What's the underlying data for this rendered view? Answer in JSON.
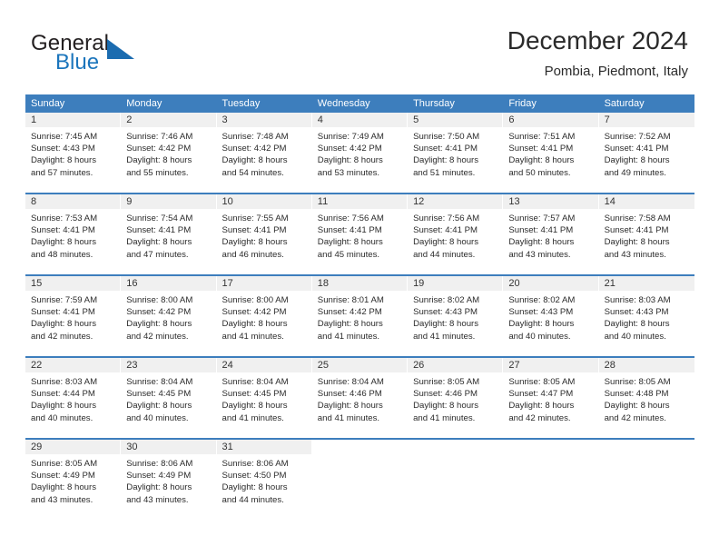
{
  "brand": {
    "name_part1": "General",
    "name_part2": "Blue",
    "logo_icon": "triangle-logo-icon",
    "accent_color": "#1b75bc"
  },
  "header": {
    "title": "December 2024",
    "subtitle": "Pombia, Piedmont, Italy"
  },
  "calendar": {
    "header_bg": "#3d7ebd",
    "day_cell_bg": "#f0f0f0",
    "weekday_headers": [
      "Sunday",
      "Monday",
      "Tuesday",
      "Wednesday",
      "Thursday",
      "Friday",
      "Saturday"
    ],
    "weeks": [
      [
        {
          "day": "1",
          "sunrise": "Sunrise: 7:45 AM",
          "sunset": "Sunset: 4:43 PM",
          "daylight_line1": "Daylight: 8 hours",
          "daylight_line2": "and 57 minutes."
        },
        {
          "day": "2",
          "sunrise": "Sunrise: 7:46 AM",
          "sunset": "Sunset: 4:42 PM",
          "daylight_line1": "Daylight: 8 hours",
          "daylight_line2": "and 55 minutes."
        },
        {
          "day": "3",
          "sunrise": "Sunrise: 7:48 AM",
          "sunset": "Sunset: 4:42 PM",
          "daylight_line1": "Daylight: 8 hours",
          "daylight_line2": "and 54 minutes."
        },
        {
          "day": "4",
          "sunrise": "Sunrise: 7:49 AM",
          "sunset": "Sunset: 4:42 PM",
          "daylight_line1": "Daylight: 8 hours",
          "daylight_line2": "and 53 minutes."
        },
        {
          "day": "5",
          "sunrise": "Sunrise: 7:50 AM",
          "sunset": "Sunset: 4:41 PM",
          "daylight_line1": "Daylight: 8 hours",
          "daylight_line2": "and 51 minutes."
        },
        {
          "day": "6",
          "sunrise": "Sunrise: 7:51 AM",
          "sunset": "Sunset: 4:41 PM",
          "daylight_line1": "Daylight: 8 hours",
          "daylight_line2": "and 50 minutes."
        },
        {
          "day": "7",
          "sunrise": "Sunrise: 7:52 AM",
          "sunset": "Sunset: 4:41 PM",
          "daylight_line1": "Daylight: 8 hours",
          "daylight_line2": "and 49 minutes."
        }
      ],
      [
        {
          "day": "8",
          "sunrise": "Sunrise: 7:53 AM",
          "sunset": "Sunset: 4:41 PM",
          "daylight_line1": "Daylight: 8 hours",
          "daylight_line2": "and 48 minutes."
        },
        {
          "day": "9",
          "sunrise": "Sunrise: 7:54 AM",
          "sunset": "Sunset: 4:41 PM",
          "daylight_line1": "Daylight: 8 hours",
          "daylight_line2": "and 47 minutes."
        },
        {
          "day": "10",
          "sunrise": "Sunrise: 7:55 AM",
          "sunset": "Sunset: 4:41 PM",
          "daylight_line1": "Daylight: 8 hours",
          "daylight_line2": "and 46 minutes."
        },
        {
          "day": "11",
          "sunrise": "Sunrise: 7:56 AM",
          "sunset": "Sunset: 4:41 PM",
          "daylight_line1": "Daylight: 8 hours",
          "daylight_line2": "and 45 minutes."
        },
        {
          "day": "12",
          "sunrise": "Sunrise: 7:56 AM",
          "sunset": "Sunset: 4:41 PM",
          "daylight_line1": "Daylight: 8 hours",
          "daylight_line2": "and 44 minutes."
        },
        {
          "day": "13",
          "sunrise": "Sunrise: 7:57 AM",
          "sunset": "Sunset: 4:41 PM",
          "daylight_line1": "Daylight: 8 hours",
          "daylight_line2": "and 43 minutes."
        },
        {
          "day": "14",
          "sunrise": "Sunrise: 7:58 AM",
          "sunset": "Sunset: 4:41 PM",
          "daylight_line1": "Daylight: 8 hours",
          "daylight_line2": "and 43 minutes."
        }
      ],
      [
        {
          "day": "15",
          "sunrise": "Sunrise: 7:59 AM",
          "sunset": "Sunset: 4:41 PM",
          "daylight_line1": "Daylight: 8 hours",
          "daylight_line2": "and 42 minutes."
        },
        {
          "day": "16",
          "sunrise": "Sunrise: 8:00 AM",
          "sunset": "Sunset: 4:42 PM",
          "daylight_line1": "Daylight: 8 hours",
          "daylight_line2": "and 42 minutes."
        },
        {
          "day": "17",
          "sunrise": "Sunrise: 8:00 AM",
          "sunset": "Sunset: 4:42 PM",
          "daylight_line1": "Daylight: 8 hours",
          "daylight_line2": "and 41 minutes."
        },
        {
          "day": "18",
          "sunrise": "Sunrise: 8:01 AM",
          "sunset": "Sunset: 4:42 PM",
          "daylight_line1": "Daylight: 8 hours",
          "daylight_line2": "and 41 minutes."
        },
        {
          "day": "19",
          "sunrise": "Sunrise: 8:02 AM",
          "sunset": "Sunset: 4:43 PM",
          "daylight_line1": "Daylight: 8 hours",
          "daylight_line2": "and 41 minutes."
        },
        {
          "day": "20",
          "sunrise": "Sunrise: 8:02 AM",
          "sunset": "Sunset: 4:43 PM",
          "daylight_line1": "Daylight: 8 hours",
          "daylight_line2": "and 40 minutes."
        },
        {
          "day": "21",
          "sunrise": "Sunrise: 8:03 AM",
          "sunset": "Sunset: 4:43 PM",
          "daylight_line1": "Daylight: 8 hours",
          "daylight_line2": "and 40 minutes."
        }
      ],
      [
        {
          "day": "22",
          "sunrise": "Sunrise: 8:03 AM",
          "sunset": "Sunset: 4:44 PM",
          "daylight_line1": "Daylight: 8 hours",
          "daylight_line2": "and 40 minutes."
        },
        {
          "day": "23",
          "sunrise": "Sunrise: 8:04 AM",
          "sunset": "Sunset: 4:45 PM",
          "daylight_line1": "Daylight: 8 hours",
          "daylight_line2": "and 40 minutes."
        },
        {
          "day": "24",
          "sunrise": "Sunrise: 8:04 AM",
          "sunset": "Sunset: 4:45 PM",
          "daylight_line1": "Daylight: 8 hours",
          "daylight_line2": "and 41 minutes."
        },
        {
          "day": "25",
          "sunrise": "Sunrise: 8:04 AM",
          "sunset": "Sunset: 4:46 PM",
          "daylight_line1": "Daylight: 8 hours",
          "daylight_line2": "and 41 minutes."
        },
        {
          "day": "26",
          "sunrise": "Sunrise: 8:05 AM",
          "sunset": "Sunset: 4:46 PM",
          "daylight_line1": "Daylight: 8 hours",
          "daylight_line2": "and 41 minutes."
        },
        {
          "day": "27",
          "sunrise": "Sunrise: 8:05 AM",
          "sunset": "Sunset: 4:47 PM",
          "daylight_line1": "Daylight: 8 hours",
          "daylight_line2": "and 42 minutes."
        },
        {
          "day": "28",
          "sunrise": "Sunrise: 8:05 AM",
          "sunset": "Sunset: 4:48 PM",
          "daylight_line1": "Daylight: 8 hours",
          "daylight_line2": "and 42 minutes."
        }
      ],
      [
        {
          "day": "29",
          "sunrise": "Sunrise: 8:05 AM",
          "sunset": "Sunset: 4:49 PM",
          "daylight_line1": "Daylight: 8 hours",
          "daylight_line2": "and 43 minutes."
        },
        {
          "day": "30",
          "sunrise": "Sunrise: 8:06 AM",
          "sunset": "Sunset: 4:49 PM",
          "daylight_line1": "Daylight: 8 hours",
          "daylight_line2": "and 43 minutes."
        },
        {
          "day": "31",
          "sunrise": "Sunrise: 8:06 AM",
          "sunset": "Sunset: 4:50 PM",
          "daylight_line1": "Daylight: 8 hours",
          "daylight_line2": "and 44 minutes."
        },
        {
          "day": "",
          "sunrise": "",
          "sunset": "",
          "daylight_line1": "",
          "daylight_line2": ""
        },
        {
          "day": "",
          "sunrise": "",
          "sunset": "",
          "daylight_line1": "",
          "daylight_line2": ""
        },
        {
          "day": "",
          "sunrise": "",
          "sunset": "",
          "daylight_line1": "",
          "daylight_line2": ""
        },
        {
          "day": "",
          "sunrise": "",
          "sunset": "",
          "daylight_line1": "",
          "daylight_line2": ""
        }
      ]
    ]
  }
}
